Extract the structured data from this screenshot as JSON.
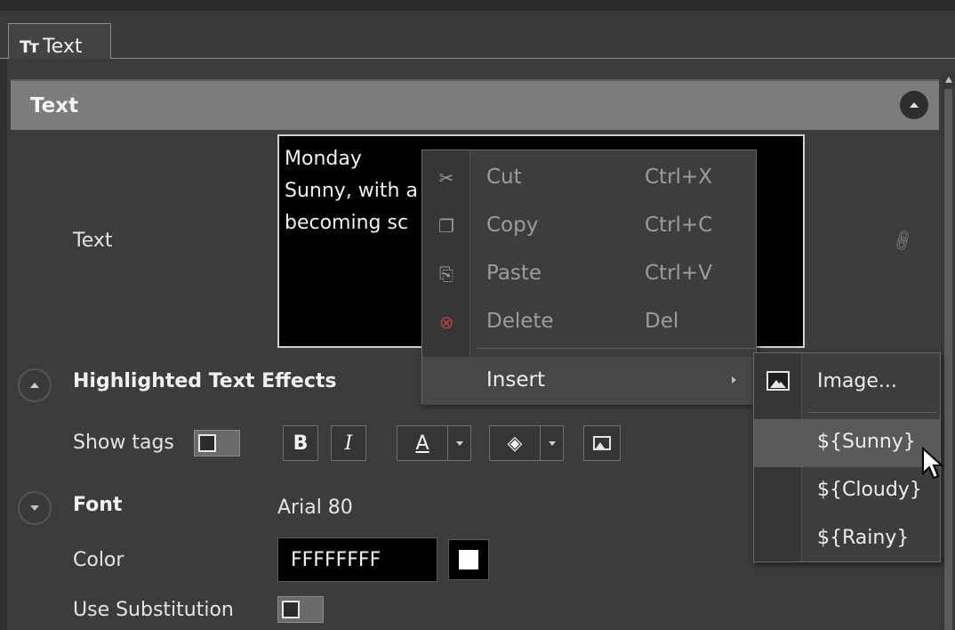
{
  "tab": {
    "icon": "Tт",
    "label": "Text"
  },
  "section": {
    "title": "Text"
  },
  "text_field": {
    "label": "Text",
    "lines": [
      "Monday",
      "Sunny, with a",
      "becoming sc"
    ]
  },
  "highlight": {
    "title": "Highlighted Text Effects",
    "show_tags_label": "Show tags"
  },
  "format_toolbar": {
    "bold": "B",
    "italic": "I",
    "font_color": "A"
  },
  "font": {
    "label": "Font",
    "value": "Arial 80"
  },
  "color": {
    "label": "Color",
    "value": "FFFFFFFF",
    "swatch": "#ffffff"
  },
  "substitution": {
    "label": "Use Substitution"
  },
  "context_menu": {
    "items": [
      {
        "icon": "scissors-icon",
        "label": "Cut",
        "shortcut": "Ctrl+X"
      },
      {
        "icon": "copy-icon",
        "label": "Copy",
        "shortcut": "Ctrl+C"
      },
      {
        "icon": "paste-icon",
        "label": "Paste",
        "shortcut": "Ctrl+V"
      },
      {
        "icon": "delete-icon",
        "label": "Delete",
        "shortcut": "Del"
      }
    ],
    "insert": "Insert"
  },
  "submenu": {
    "image": "Image...",
    "variables": [
      "${Sunny}",
      "${Cloudy}",
      "${Rainy}"
    ]
  }
}
